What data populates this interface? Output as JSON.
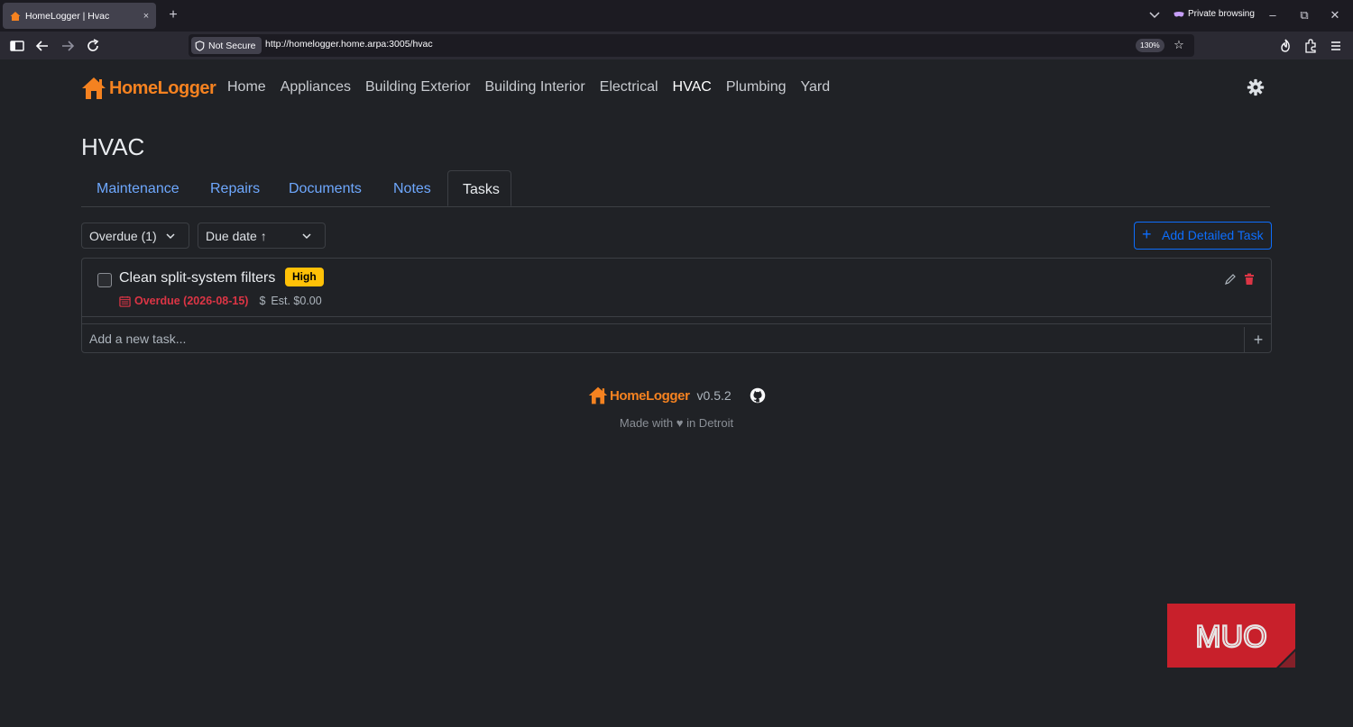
{
  "browser": {
    "tab_title": "HomeLogger | Hvac",
    "tab_close": "×",
    "new_tab": "+",
    "private_label": "Private browsing",
    "minimize": "–",
    "restore": "⧉",
    "close": "✕",
    "security_label": "Not Secure",
    "url": "http://homelogger.home.arpa:3005/hvac",
    "zoom": "130%"
  },
  "app": {
    "brand": "HomeLogger",
    "nav": [
      "Home",
      "Appliances",
      "Building Exterior",
      "Building Interior",
      "Electrical",
      "HVAC",
      "Plumbing",
      "Yard"
    ],
    "active_nav": "HVAC",
    "page_title": "HVAC",
    "tabs": [
      "Maintenance",
      "Repairs",
      "Documents",
      "Notes",
      "Tasks"
    ],
    "active_tab": "Tasks",
    "filter_label": "Overdue (1)",
    "sort_label": "Due date ↑",
    "add_button": "Add Detailed Task",
    "tasks": [
      {
        "name": "Clean split-system filters",
        "priority": "High",
        "status": "Overdue (2026-08-15)",
        "cost": "Est. $0.00",
        "cost_symbol": "$"
      }
    ],
    "new_task_placeholder": "Add a new task...",
    "new_task_add": "+"
  },
  "footer": {
    "brand": "HomeLogger",
    "version": "v0.5.2",
    "made_with": "Made with ♥ in Detroit"
  },
  "watermark": "MUO",
  "colors": {
    "brand": "#f58220",
    "link": "#6ea8fe",
    "primary": "#0d6efd",
    "danger": "#dc3545",
    "warning": "#ffc107",
    "background": "#202226",
    "watermark": "#c8202b"
  }
}
